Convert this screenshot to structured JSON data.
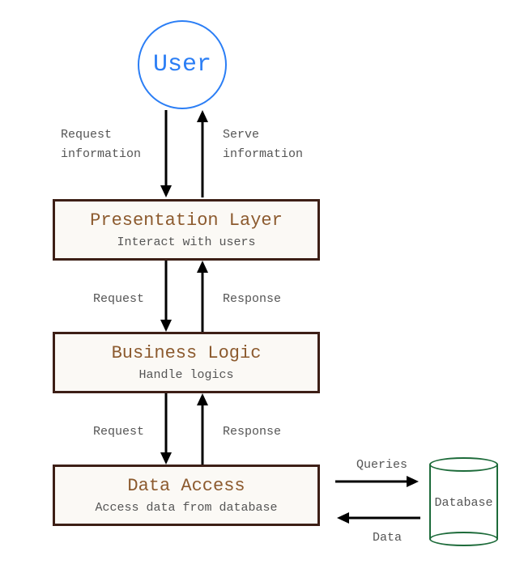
{
  "user": {
    "label": "User"
  },
  "layers": {
    "presentation": {
      "title": "Presentation Layer",
      "subtitle": "Interact with users"
    },
    "business": {
      "title": "Business Logic",
      "subtitle": "Handle logics"
    },
    "data_access": {
      "title": "Data Access",
      "subtitle": "Access data from database"
    }
  },
  "database": {
    "label": "Database"
  },
  "connections": {
    "user_to_presentation_left": "Request\ninformation",
    "user_to_presentation_right": "Serve\ninformation",
    "presentation_to_business_left": "Request",
    "presentation_to_business_right": "Response",
    "business_to_data_left": "Request",
    "business_to_data_right": "Response",
    "data_to_db_top": "Queries",
    "data_to_db_bottom": "Data"
  }
}
